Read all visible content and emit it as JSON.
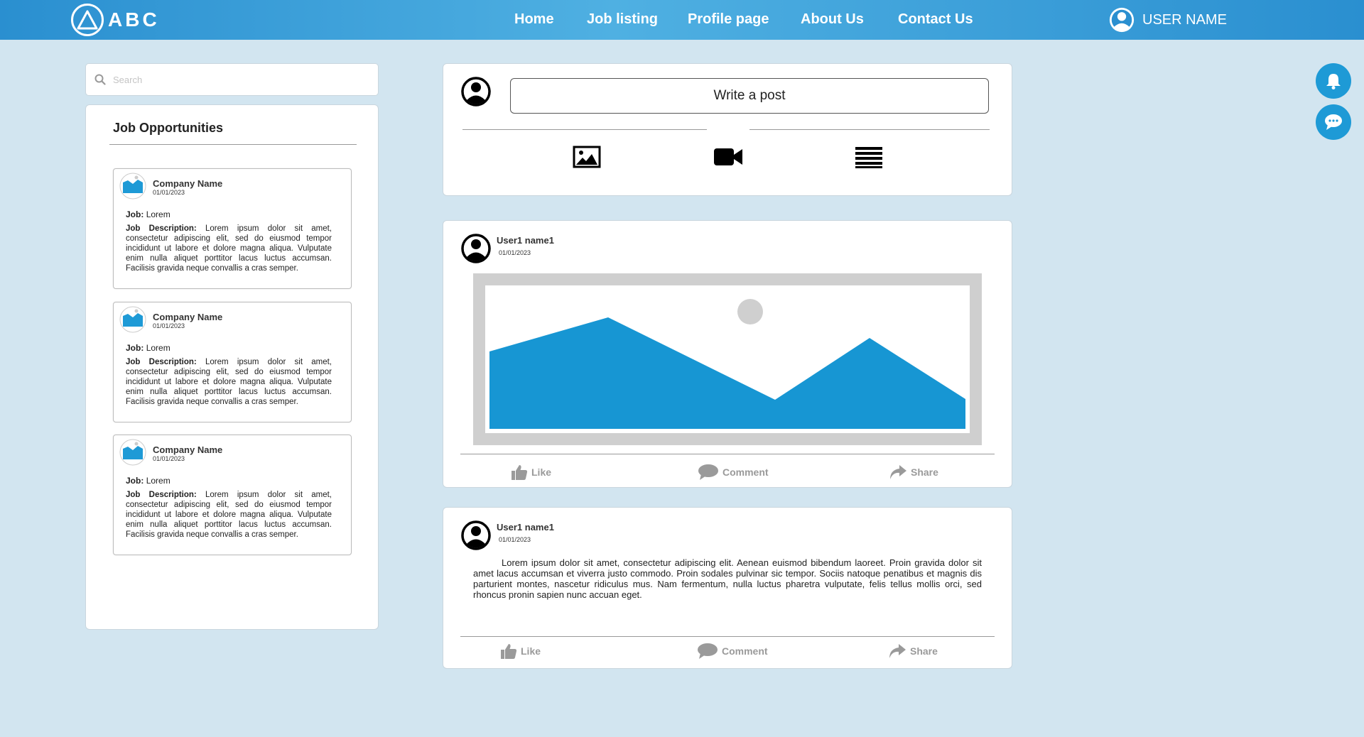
{
  "brand": {
    "name": "ABC"
  },
  "nav": {
    "home": "Home",
    "job_listing": "Job listing",
    "profile_page": "Profile page",
    "about_us": "About Us",
    "contact_us": "Contact Us"
  },
  "user": {
    "name": "USER NAME"
  },
  "search": {
    "placeholder": "Search"
  },
  "jobs": {
    "title": "Job Opportunities",
    "items": [
      {
        "company": "Company Name",
        "date": "01/01/2023",
        "job_label": "Job:",
        "job": "Lorem",
        "desc_label": "Job Description:",
        "description": "Lorem ipsum dolor sit amet, consectetur adipiscing elit, sed do eiusmod tempor incididunt ut labore et dolore magna aliqua. Vulputate enim nulla aliquet porttitor lacus luctus accumsan. Facilisis gravida neque convallis a cras semper."
      },
      {
        "company": "Company Name",
        "date": "01/01/2023",
        "job_label": "Job:",
        "job": "Lorem",
        "desc_label": "Job Description:",
        "description": "Lorem ipsum dolor sit amet, consectetur adipiscing elit, sed do eiusmod tempor incididunt ut labore et dolore magna aliqua. Vulputate enim nulla aliquet porttitor lacus luctus accumsan. Facilisis gravida neque convallis a cras semper."
      },
      {
        "company": "Company Name",
        "date": "01/01/2023",
        "job_label": "Job:",
        "job": "Lorem",
        "desc_label": "Job Description:",
        "description": "Lorem ipsum dolor sit amet, consectetur adipiscing elit, sed do eiusmod tempor incididunt ut labore et dolore magna aliqua. Vulputate enim nulla aliquet porttitor lacus luctus accumsan. Facilisis gravida neque convallis a cras semper."
      }
    ]
  },
  "composer": {
    "write_label": "Write a post"
  },
  "posts": [
    {
      "user": "User1 name1",
      "date": "01/01/2023",
      "like": "Like",
      "comment": "Comment",
      "share": "Share"
    },
    {
      "user": "User1 name1",
      "date": "01/01/2023",
      "text": "Lorem ipsum dolor sit amet, consectetur adipiscing elit. Aenean euismod bibendum laoreet. Proin gravida dolor sit amet lacus accumsan et viverra justo commodo. Proin sodales pulvinar sic tempor. Sociis natoque penatibus et magnis dis parturient montes, nascetur ridiculus mus. Nam fermentum, nulla luctus pharetra vulputate, felis tellus mollis orci, sed rhoncus pronin sapien nunc accuan eget.",
      "like": "Like",
      "comment": "Comment",
      "share": "Share"
    }
  ],
  "icons": {
    "logo": "logo-mark-icon",
    "user": "user-avatar-icon",
    "search": "search-icon",
    "image": "image-icon",
    "video": "video-camera-icon",
    "article": "text-lines-icon",
    "like": "thumbs-up-icon",
    "comment": "comment-bubble-icon",
    "share": "share-arrow-icon",
    "notifications": "bell-icon",
    "messages": "chat-icon"
  },
  "colors": {
    "header_blue": "#2a8fd0",
    "accent_blue": "#1e9ad6",
    "page_bg": "#d2e5f0",
    "action_gray": "#9a9a9a"
  }
}
